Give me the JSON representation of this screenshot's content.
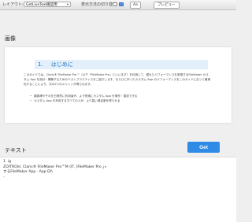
{
  "toolbar": {
    "layout_label": "レイアウト:",
    "layout_value": "GetLiveText確認用",
    "table_label": "表示方法の切り替え:",
    "aa_label": "Aa",
    "preview_label": "プレビュー"
  },
  "image_section": {
    "title": "画像",
    "doc": {
      "number": "1.",
      "heading": "はじめに",
      "paragraph": "このガイドでは、Claris® FileMaker Pro™（以下「FileMaker Pro」といいます）を利用して、優れたパフォーマンスを実現するFileMaker カスタム App を設計・構築するためのベストプラクティスをご紹介します。ならびに作ったカスタム App のパフォーマンスをこのガイドに沿って最適化することにより、次の2つのメリットが得られます。",
      "bullets": [
        "顧客様やそれを日常的に利用者が、より快適にカスタム App を操作・運用できる",
        "カスタム App を利用するすべての人が、より高い満足度を得られる"
      ]
    }
  },
  "text_section": {
    "title": "テキスト",
    "get_button": "Get",
    "lines": [
      "1. ig",
      "ZOITROld. Claris® FileMaker Pro™M (IT. [FileMaker Pro ¿»",
      "するFileMaker App · App D/\\",
      "-"
    ]
  }
}
